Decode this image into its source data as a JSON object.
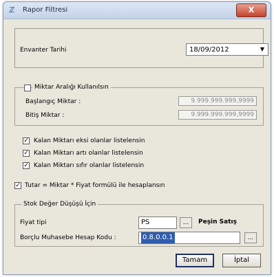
{
  "window": {
    "title": "Rapor Filtresi",
    "close_label": "X"
  },
  "envanter": {
    "label": "Envanter Tarihi",
    "date_value": "18/09/2012"
  },
  "miktar_group": {
    "checkbox_label": "Miktar Aralığı Kullanılsın",
    "start_label": "Başlangıç Miktar :",
    "start_value": "9.999.999.999,9999",
    "end_label": "Bitiş Miktar :",
    "end_value": "9.999.999.999,9999"
  },
  "list_options": [
    {
      "label": "Kalan Miktarı eksi olanlar listelensin",
      "checked": true
    },
    {
      "label": "Kalan Miktarı artı olanlar listelensin",
      "checked": true
    },
    {
      "label": "Kalan Miktarı sıfır olanlar listelensin",
      "checked": true
    }
  ],
  "formula": {
    "label": "Tutar = Miktar * Fiyat formülü ile hesaplansın",
    "checked": true
  },
  "stok_group": {
    "legend": "Stok Değer Düşüşü İçin",
    "fiyat_label": "Fiyat tipi",
    "fiyat_value": "PS",
    "fiyat_desc": "Peşin Satış",
    "hesap_label": "Borçlu Muhasebe Hesap Kodu :",
    "hesap_value": "0.8.0.0.1"
  },
  "buttons": {
    "ok": "Tamam",
    "cancel": "İptal"
  }
}
